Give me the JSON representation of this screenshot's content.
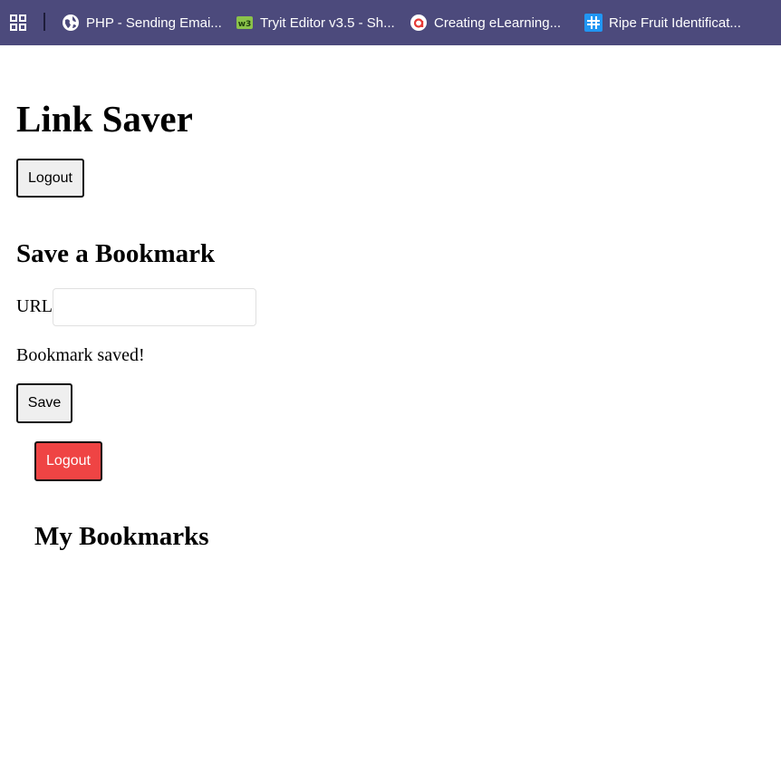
{
  "bookmarks_bar": {
    "apps_icon": "apps-grid-icon",
    "items": [
      {
        "label": "PHP - Sending Emai...",
        "icon": "globe-icon"
      },
      {
        "label": "Tryit Editor v3.5 - Sh...",
        "icon": "w3schools-icon"
      },
      {
        "label": "Creating eLearning...",
        "icon": "articulate-icon"
      },
      {
        "label": "Ripe Fruit Identificat...",
        "icon": "hashnode-icon"
      }
    ]
  },
  "page": {
    "title": "Link Saver",
    "logout_label": "Logout",
    "save_section": {
      "title": "Save a Bookmark",
      "url_label": "URL",
      "url_value": "",
      "status_message": "Bookmark saved!",
      "save_label": "Save"
    },
    "logout_red_label": "Logout",
    "bookmarks_title": "My Bookmarks"
  },
  "colors": {
    "bookmarks_bar_bg": "#4c4a7c",
    "logout_red": "#ef4444"
  }
}
